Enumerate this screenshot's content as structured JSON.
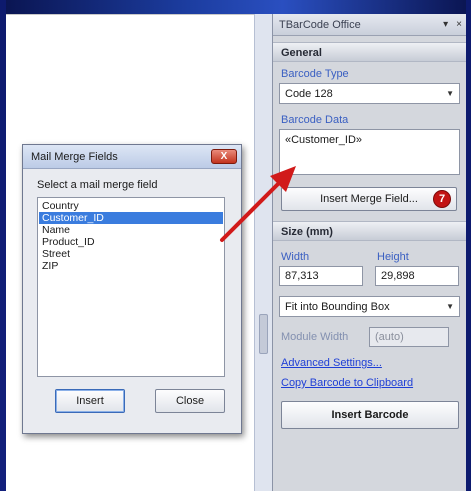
{
  "panel": {
    "title": "TBarCode Office",
    "pin_glyph": "▾",
    "close_glyph": "×",
    "general": {
      "header": "General",
      "barcode_type_label": "Barcode Type",
      "barcode_type_value": "Code 128",
      "barcode_data_label": "Barcode Data",
      "barcode_data_value": "«Customer_ID»",
      "insert_merge_field_label": "Insert Merge Field...",
      "step_badge": "7"
    },
    "size": {
      "header": "Size (mm)",
      "width_label": "Width",
      "width_value": "87,313",
      "height_label": "Height",
      "height_value": "29,898",
      "fit_value": "Fit into Bounding Box",
      "module_width_label": "Module Width",
      "module_width_value": "(auto)"
    },
    "advanced_settings_label": "Advanced Settings...",
    "copy_barcode_label": "Copy Barcode to Clipboard",
    "insert_barcode_label": "Insert Barcode"
  },
  "dialog": {
    "title": "Mail Merge Fields",
    "close_glyph": "X",
    "prompt": "Select a mail merge field",
    "items": [
      "Country",
      "Customer_ID",
      "Name",
      "Product_ID",
      "Street",
      "ZIP"
    ],
    "selected_index": 1,
    "insert_label": "Insert",
    "close_label": "Close"
  },
  "colors": {
    "accent_link": "#1f3fd6",
    "selection": "#3a7cde",
    "arrow": "#d11a1a",
    "badge": "#c21414"
  }
}
